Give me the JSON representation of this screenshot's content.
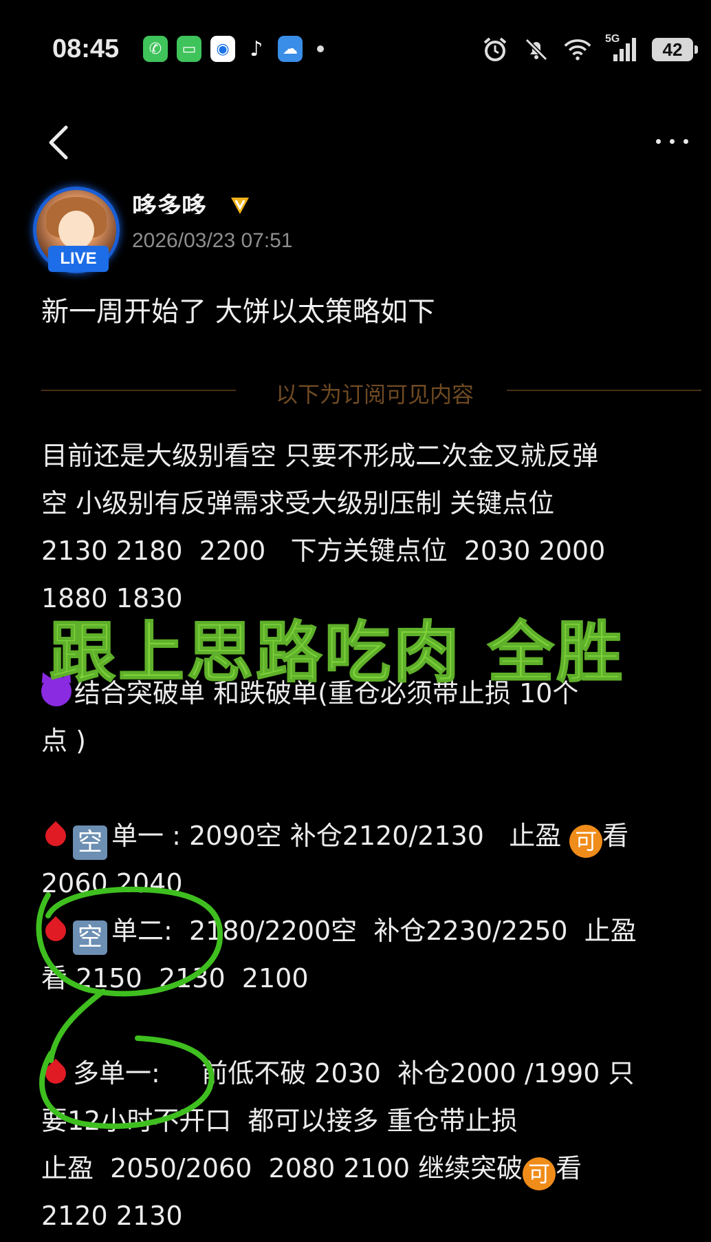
{
  "status_bar": {
    "time": "08:45",
    "app_icons": [
      {
        "name": "phone-app-icon",
        "color": "#3fc35b",
        "glyph": "✆"
      },
      {
        "name": "messages-app-icon",
        "color": "#3fc35b",
        "glyph": "▭"
      },
      {
        "name": "browser-app-icon",
        "color": "#ffffff",
        "glyph": "◉"
      },
      {
        "name": "tiktok-app-icon",
        "color": "#000000",
        "glyph": "♪"
      },
      {
        "name": "weather-app-icon",
        "color": "#3a8ee8",
        "glyph": "☁"
      }
    ],
    "network": "5G",
    "battery": "42"
  },
  "nav": {
    "back_icon": "chevron-left-icon",
    "more_icon": "more-dots-icon"
  },
  "author": {
    "name": "哆多哆",
    "live_badge": "LIVE",
    "post_time": "2026/03/23 07:51"
  },
  "post": {
    "title": "新一周开始了 大饼以太策略如下",
    "divider_label": "以下为订阅可见内容",
    "paragraphs": {
      "p1": "目前还是大级别看空 只要不形成二次金叉就反弹",
      "p2": "空 小级别有反弹需求受大级别压制 关键点位",
      "p3": "2130 2180  2200   下方关键点位  2030 2000",
      "p4": "1880 1830",
      "p5": "结合突破单 和跌破单(重仓必须带止损 10个",
      "p6": "点 )",
      "s1a": "单一 : 2090空 补仓2120/2130   止盈",
      "s1b": "看",
      "s1c": "2060 2040",
      "s2a": "单二:  2180/2200空  补仓2230/2250  止盈",
      "s2b": "看 2150  2130  2100",
      "l1a": "多单一:     前低不破 2030  补仓2000 /1990 只",
      "l1b": "要12小时不开口  都可以接多 重仓带止损",
      "l1c": "止盈  2050/2060  2080 2100 继续突破",
      "l1d": "看",
      "l1e": "2120 2130"
    },
    "kong_glyph": "空",
    "ke_glyph": "可"
  },
  "overlay": {
    "text": "跟上思路吃肉  全胜",
    "color": "#7fd43b"
  },
  "annotation_color": "#3fbf1f"
}
